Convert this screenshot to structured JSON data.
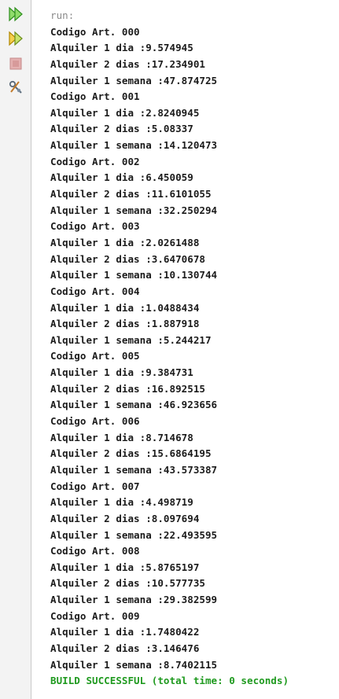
{
  "toolbar": {
    "buttons": [
      {
        "name": "rerun-button",
        "icon": "double-play-icon",
        "color": "#2fa52f"
      },
      {
        "name": "rerun-with-params-button",
        "icon": "double-play-icon",
        "color": "#e3b325"
      },
      {
        "name": "stop-button",
        "icon": "stop-icon",
        "color": "#d79a9a"
      },
      {
        "name": "settings-button",
        "icon": "tools-icon",
        "color": "#6a7a8a"
      }
    ]
  },
  "console": {
    "run_label": "run:",
    "lines": [
      "Codigo Art. 000",
      "Alquiler 1 dia :9.574945",
      "Alquiler 2 dias :17.234901",
      "Alquiler 1 semana :47.874725",
      "Codigo Art. 001",
      "Alquiler 1 dia :2.8240945",
      "Alquiler 2 dias :5.08337",
      "Alquiler 1 semana :14.120473",
      "Codigo Art. 002",
      "Alquiler 1 dia :6.450059",
      "Alquiler 2 dias :11.6101055",
      "Alquiler 1 semana :32.250294",
      "Codigo Art. 003",
      "Alquiler 1 dia :2.0261488",
      "Alquiler 2 dias :3.6470678",
      "Alquiler 1 semana :10.130744",
      "Codigo Art. 004",
      "Alquiler 1 dia :1.0488434",
      "Alquiler 2 dias :1.887918",
      "Alquiler 1 semana :5.244217",
      "Codigo Art. 005",
      "Alquiler 1 dia :9.384731",
      "Alquiler 2 dias :16.892515",
      "Alquiler 1 semana :46.923656",
      "Codigo Art. 006",
      "Alquiler 1 dia :8.714678",
      "Alquiler 2 dias :15.6864195",
      "Alquiler 1 semana :43.573387",
      "Codigo Art. 007",
      "Alquiler 1 dia :4.498719",
      "Alquiler 2 dias :8.097694",
      "Alquiler 1 semana :22.493595",
      "Codigo Art. 008",
      "Alquiler 1 dia :5.8765197",
      "Alquiler 2 dias :10.577735",
      "Alquiler 1 semana :29.382599",
      "Codigo Art. 009",
      "Alquiler 1 dia :1.7480422",
      "Alquiler 2 dias :3.146476",
      "Alquiler 1 semana :8.7402115"
    ],
    "build_status": "BUILD SUCCESSFUL (total time: 0 seconds)",
    "build_status_color": "#1f9a1f"
  }
}
